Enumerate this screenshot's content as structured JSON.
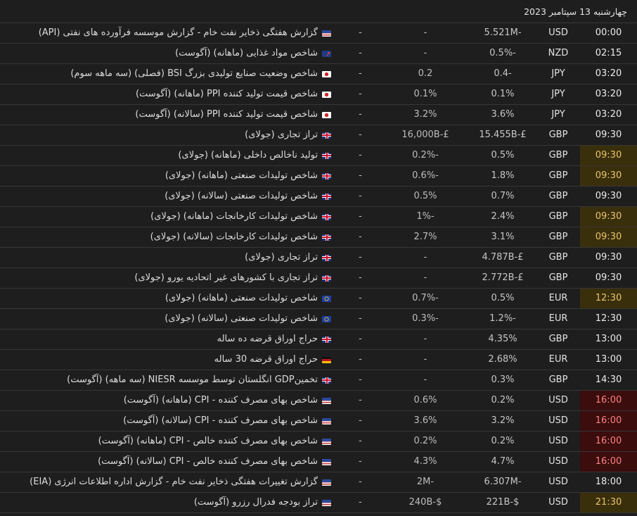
{
  "date_label": "چهارشنبه 13 سپتامبر 2023",
  "colors": {
    "highlight_yellow": "#3a2f0b",
    "highlight_red": "#3b0d0d",
    "background": "#1e1e1e"
  },
  "events": [
    {
      "time": "00:00",
      "currency": "USD",
      "actual": "",
      "forecast": "5.521M-",
      "previous": "-",
      "extra": "-",
      "flag": "us-flag-icon",
      "title": "گزارش هفتگی ذخایر نفت خام - گزارش موسسه فرآورده های نفتی (API)",
      "highlight": ""
    },
    {
      "time": "02:15",
      "currency": "NZD",
      "actual": "",
      "forecast": "0.5%-",
      "previous": "-",
      "extra": "-",
      "flag": "nz-flag-icon",
      "title": "شاخص مواد غذایی (ماهانه) (آگوست)",
      "highlight": ""
    },
    {
      "time": "03:20",
      "currency": "JPY",
      "actual": "",
      "forecast": "0.4-",
      "previous": "0.2",
      "extra": "-",
      "flag": "jp-flag-icon",
      "title": "شاخص وضعیت صنایع تولیدی بزرگ BSI (فصلی) (سه ماهه سوم)",
      "highlight": ""
    },
    {
      "time": "03:20",
      "currency": "JPY",
      "actual": "",
      "forecast": "0.1%",
      "previous": "0.1%",
      "extra": "-",
      "flag": "jp-flag-icon",
      "title": "شاخص قیمت تولید کننده PPI (ماهانه) (آگوست)",
      "highlight": ""
    },
    {
      "time": "03:20",
      "currency": "JPY",
      "actual": "",
      "forecast": "3.6%",
      "previous": "3.2%",
      "extra": "-",
      "flag": "jp-flag-icon",
      "title": "شاخص قیمت تولید کننده PPI (سالانه) (آگوست)",
      "highlight": ""
    },
    {
      "time": "09:30",
      "currency": "GBP",
      "actual": "",
      "forecast": "15.455B-£",
      "previous": "16,000B-£",
      "extra": "-",
      "flag": "gb-flag-icon",
      "title": "تراز تجاری (جولای)",
      "highlight": ""
    },
    {
      "time": "09:30",
      "currency": "GBP",
      "actual": "",
      "forecast": "0.5%",
      "previous": "0.2%-",
      "extra": "-",
      "flag": "gb-flag-icon",
      "title": "تولید ناخالص داخلی (ماهانه) (جولای)",
      "highlight": "yellow"
    },
    {
      "time": "09:30",
      "currency": "GBP",
      "actual": "",
      "forecast": "1.8%",
      "previous": "0.6%-",
      "extra": "-",
      "flag": "gb-flag-icon",
      "title": "شاخص تولیدات صنعتی (ماهانه) (جولای)",
      "highlight": "yellow"
    },
    {
      "time": "09:30",
      "currency": "GBP",
      "actual": "",
      "forecast": "0.7%",
      "previous": "0.5%",
      "extra": "-",
      "flag": "gb-flag-icon",
      "title": "شاخص تولیدات صنعتی (سالانه) (جولای)",
      "highlight": ""
    },
    {
      "time": "09:30",
      "currency": "GBP",
      "actual": "",
      "forecast": "2.4%",
      "previous": "1%-",
      "extra": "-",
      "flag": "gb-flag-icon",
      "title": "شاخص تولیدات کارخانجات (ماهانه) (جولای)",
      "highlight": "yellow"
    },
    {
      "time": "09:30",
      "currency": "GBP",
      "actual": "",
      "forecast": "3.1%",
      "previous": "2.7%",
      "extra": "-",
      "flag": "gb-flag-icon",
      "title": "شاخص تولیدات کارخانجات (سالانه) (جولای)",
      "highlight": "yellow"
    },
    {
      "time": "09:30",
      "currency": "GBP",
      "actual": "",
      "forecast": "4.787B-£",
      "previous": "-",
      "extra": "-",
      "flag": "gb-flag-icon",
      "title": "تراز تجاری (جولای)",
      "highlight": ""
    },
    {
      "time": "09:30",
      "currency": "GBP",
      "actual": "",
      "forecast": "2.772B-£",
      "previous": "-",
      "extra": "-",
      "flag": "gb-flag-icon",
      "title": "تراز تجاری با کشورهای غیر اتحادیه یورو (جولای)",
      "highlight": ""
    },
    {
      "time": "12:30",
      "currency": "EUR",
      "actual": "",
      "forecast": "0.5%",
      "previous": "0.7%-",
      "extra": "-",
      "flag": "eu-flag-icon",
      "title": "شاخص تولیدات صنعتی (ماهانه) (جولای)",
      "highlight": "yellow"
    },
    {
      "time": "12:30",
      "currency": "EUR",
      "actual": "",
      "forecast": "1.2%-",
      "previous": "0.3%-",
      "extra": "-",
      "flag": "eu-flag-icon",
      "title": "شاخص تولیدات صنعتی (سالانه) (جولای)",
      "highlight": ""
    },
    {
      "time": "13:00",
      "currency": "GBP",
      "actual": "",
      "forecast": "4.35%",
      "previous": "-",
      "extra": "-",
      "flag": "gb-flag-icon",
      "title": "حراج اوراق قرضه ده ساله",
      "highlight": ""
    },
    {
      "time": "13:00",
      "currency": "EUR",
      "actual": "",
      "forecast": "2.68%",
      "previous": "-",
      "extra": "-",
      "flag": "de-flag-icon",
      "title": "حراج اوراق قرضه 30 ساله",
      "highlight": ""
    },
    {
      "time": "14:30",
      "currency": "GBP",
      "actual": "",
      "forecast": "0.3%",
      "previous": "-",
      "extra": "-",
      "flag": "gb-flag-icon",
      "title": "تخمینGDP انگلستان توسط موسسه NIESR (سه ماهه) (آگوست)",
      "highlight": ""
    },
    {
      "time": "16:00",
      "currency": "USD",
      "actual": "",
      "forecast": "0.2%",
      "previous": "0.6%",
      "extra": "-",
      "flag": "us-flag-icon",
      "title": "شاخص بهای مصرف کننده - CPI (ماهانه) (آگوست)",
      "highlight": "red"
    },
    {
      "time": "16:00",
      "currency": "USD",
      "actual": "",
      "forecast": "3.2%",
      "previous": "3.6%",
      "extra": "-",
      "flag": "us-flag-icon",
      "title": "شاخص بهای مصرف کننده - CPI (سالانه) (آگوست)",
      "highlight": "red"
    },
    {
      "time": "16:00",
      "currency": "USD",
      "actual": "",
      "forecast": "0.2%",
      "previous": "0.2%",
      "extra": "-",
      "flag": "us-flag-icon",
      "title": "شاخص بهای مصرف کننده خالص - CPI (ماهانه) (آگوست)",
      "highlight": "red"
    },
    {
      "time": "16:00",
      "currency": "USD",
      "actual": "",
      "forecast": "4.7%",
      "previous": "4.3%",
      "extra": "-",
      "flag": "us-flag-icon",
      "title": "شاخص بهای مصرف کننده خالص - CPI (سالانه) (آگوست)",
      "highlight": "red"
    },
    {
      "time": "18:00",
      "currency": "USD",
      "actual": "",
      "forecast": "6.307M-",
      "previous": "2M-",
      "extra": "-",
      "flag": "us-flag-icon",
      "title": "گزارش تغییرات هفتگی ذخایر نفت خام - گزارش اداره اطلاعات انرژی (EIA)",
      "highlight": ""
    },
    {
      "time": "21:30",
      "currency": "USD",
      "actual": "",
      "forecast": "221B-$",
      "previous": "240B-$",
      "extra": "-",
      "flag": "us-flag-icon",
      "title": "تراز بودجه فدرال رزرو (آگوست)",
      "highlight": "yellow"
    }
  ]
}
